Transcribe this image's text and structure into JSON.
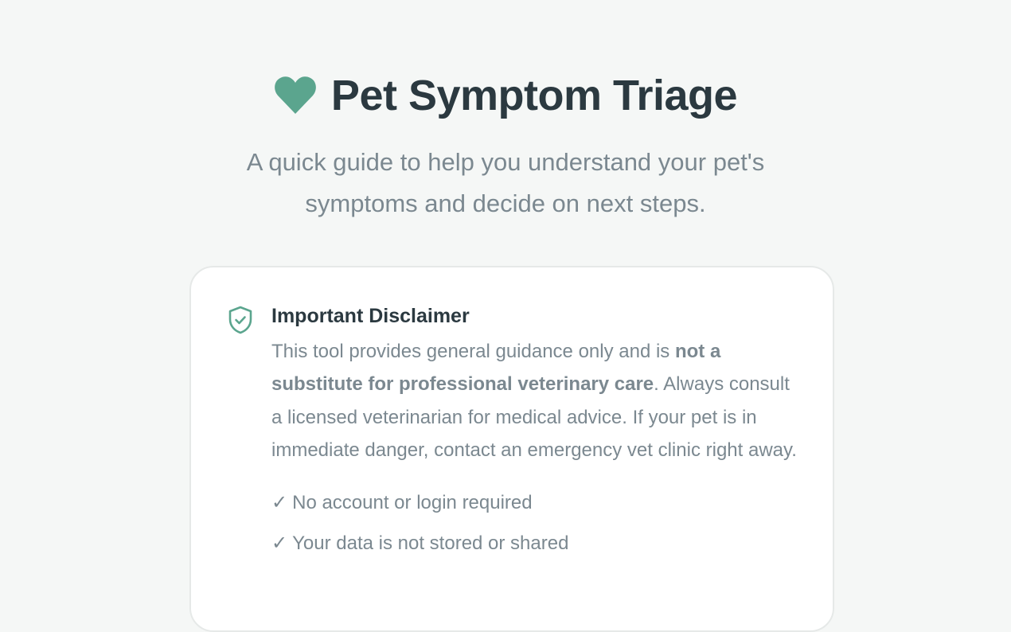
{
  "header": {
    "icon": "heart-icon",
    "title": "Pet Symptom Triage",
    "subtitle": "A quick guide to help you understand your pet's symptoms and decide on next steps."
  },
  "disclaimer": {
    "icon": "shield-check-icon",
    "title": "Important Disclaimer",
    "text_before": "This tool provides general guidance only and is ",
    "text_bold": "not a substitute for professional veterinary care",
    "text_after": ". Always consult a licensed veterinarian for medical advice. If your pet is in immediate danger, contact an emergency vet clinic right away.",
    "features": [
      {
        "check": "✓",
        "label": "No account or login required"
      },
      {
        "check": "✓",
        "label": "Your data is not stored or shared"
      }
    ]
  },
  "colors": {
    "accent": "#5ba58e",
    "background": "#f5f7f6",
    "heading": "#2b3940",
    "muted": "#7b8890"
  }
}
